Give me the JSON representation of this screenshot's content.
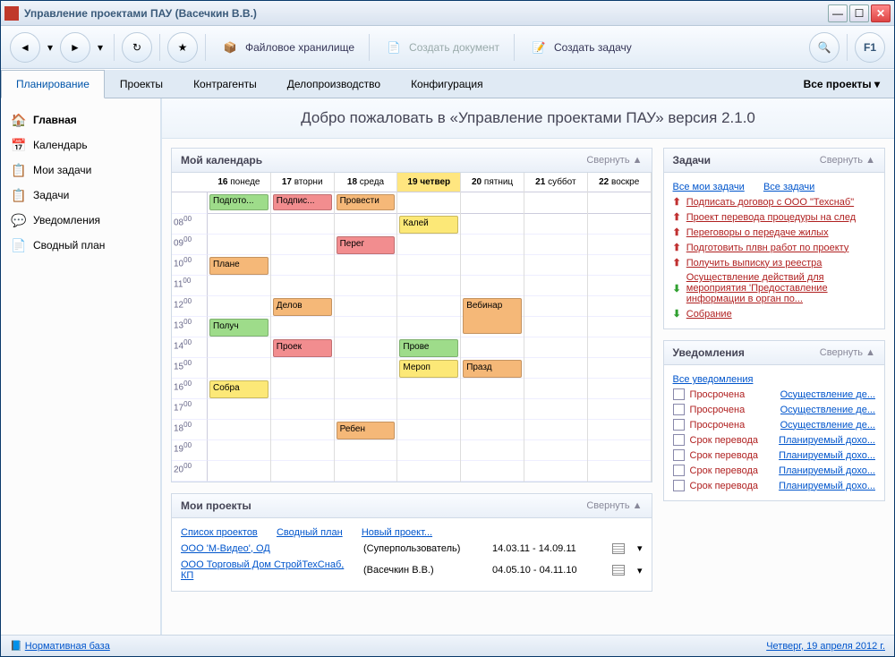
{
  "title": "Управление проектами ПАУ (Васечкин В.В.)",
  "toolbar": {
    "file_storage": "Файловое хранилище",
    "create_doc": "Создать документ",
    "create_task": "Создать задачу"
  },
  "tabs": [
    "Планирование",
    "Проекты",
    "Контрагенты",
    "Делопроизводство",
    "Конфигурация"
  ],
  "all_projects": "Все проекты",
  "sidebar": [
    {
      "icon": "🏠",
      "label": "Главная"
    },
    {
      "icon": "📅",
      "label": "Календарь"
    },
    {
      "icon": "📋",
      "label": "Мои задачи"
    },
    {
      "icon": "📋",
      "label": "Задачи"
    },
    {
      "icon": "💬",
      "label": "Уведомления"
    },
    {
      "icon": "📄",
      "label": "Сводный план"
    }
  ],
  "welcome": "Добро пожаловать в «Управление проектами ПАУ» версия 2.1.0",
  "collapse": "Свернуть",
  "calendar": {
    "title": "Мой календарь",
    "days": [
      {
        "num": "16",
        "name": "понеде"
      },
      {
        "num": "17",
        "name": "вторни"
      },
      {
        "num": "18",
        "name": "среда"
      },
      {
        "num": "19",
        "name": "четвер"
      },
      {
        "num": "20",
        "name": "пятниц"
      },
      {
        "num": "21",
        "name": "суббот"
      },
      {
        "num": "22",
        "name": "воскре"
      }
    ],
    "hours": [
      "08",
      "09",
      "10",
      "11",
      "12",
      "13",
      "14",
      "15",
      "16",
      "17",
      "18",
      "19",
      "20"
    ],
    "allday": [
      {
        "day": 0,
        "text": "Подгото...",
        "cls": "ev-green"
      },
      {
        "day": 1,
        "text": "Подпис...",
        "cls": "ev-red"
      },
      {
        "day": 2,
        "text": "Провести",
        "cls": "ev-orange"
      }
    ],
    "events": [
      {
        "day": 0,
        "hour": 2,
        "text": "Плане",
        "cls": "ev-orange"
      },
      {
        "day": 0,
        "hour": 5,
        "text": "Получ",
        "cls": "ev-green"
      },
      {
        "day": 0,
        "hour": 8,
        "text": "Собра",
        "cls": "ev-yellow"
      },
      {
        "day": 1,
        "hour": 4,
        "text": "Делов",
        "cls": "ev-orange"
      },
      {
        "day": 1,
        "hour": 6,
        "text": "Проек",
        "cls": "ev-red"
      },
      {
        "day": 2,
        "hour": 1,
        "text": "Перег",
        "cls": "ev-red"
      },
      {
        "day": 2,
        "hour": 10,
        "text": "Ребен",
        "cls": "ev-orange"
      },
      {
        "day": 3,
        "hour": 0,
        "text": "Калей",
        "cls": "ev-yellow"
      },
      {
        "day": 3,
        "hour": 6,
        "text": "Прове",
        "cls": "ev-green"
      },
      {
        "day": 3,
        "hour": 7,
        "text": "Мероп",
        "cls": "ev-yellow"
      },
      {
        "day": 4,
        "hour": 4,
        "text": "Вебинар",
        "cls": "ev-orange",
        "tall": true
      },
      {
        "day": 4,
        "hour": 7,
        "text": "Празд",
        "cls": "ev-orange"
      }
    ]
  },
  "projects_panel": {
    "title": "Мои проекты",
    "links": [
      "Список проектов",
      "Сводный план",
      "Новый проект..."
    ],
    "rows": [
      {
        "name": "ООО 'М-Видео', ОД",
        "user": "(Суперпользователь)",
        "dates": "14.03.11 - 14.09.11"
      },
      {
        "name": "ООО Торговый Дом СтройТехСнаб, КП",
        "user": "(Васечкин В.В.)",
        "dates": "04.05.10 - 04.11.10"
      }
    ]
  },
  "tasks_panel": {
    "title": "Задачи",
    "my_tasks": "Все мои задачи",
    "all_tasks": "Все задачи",
    "items": [
      {
        "dir": "up",
        "text": "Подписать договор с ООО \"Техснаб\""
      },
      {
        "dir": "up",
        "text": "Проект перевода процедуры на след"
      },
      {
        "dir": "up",
        "text": "Переговоры о передаче жилых"
      },
      {
        "dir": "up",
        "text": "Подготовить плвн работ по проекту"
      },
      {
        "dir": "up",
        "text": "Получить выписку из реестра"
      },
      {
        "dir": "down",
        "text": "Осуществление действий для мероприятия 'Предоставление информации в орган по..."
      },
      {
        "dir": "down",
        "text": "Собрание"
      }
    ]
  },
  "notif_panel": {
    "title": "Уведомления",
    "all": "Все уведомления",
    "items": [
      {
        "status": "Просрочена",
        "link": "Осуществление де..."
      },
      {
        "status": "Просрочена",
        "link": "Осуществление де..."
      },
      {
        "status": "Просрочена",
        "link": "Осуществление де..."
      },
      {
        "status": "Срок перевода",
        "link": "Планируемый дохо..."
      },
      {
        "status": "Срок перевода",
        "link": "Планируемый дохо..."
      },
      {
        "status": "Срок перевода",
        "link": "Планируемый дохо..."
      },
      {
        "status": "Срок перевода",
        "link": "Планируемый дохо..."
      }
    ]
  },
  "status": {
    "left": "Нормативная база",
    "right": "Четверг, 19 апреля 2012 г."
  }
}
